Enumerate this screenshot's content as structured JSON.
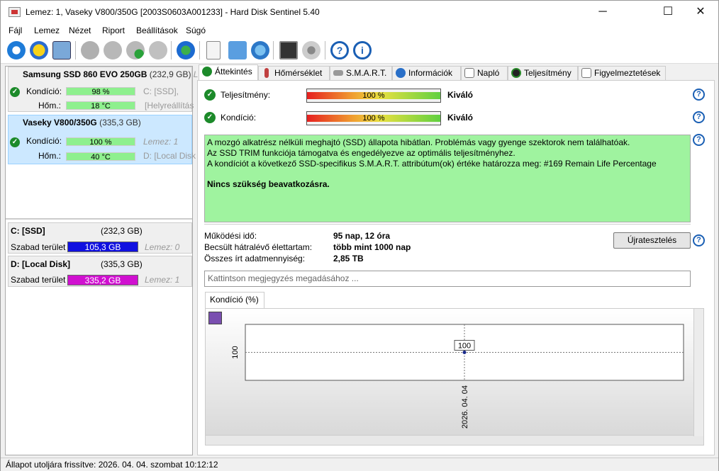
{
  "window": {
    "title": "Lemez: 1, Vaseky V800/350G [2003S0603A001233]  -  Hard Disk Sentinel 5.40",
    "min": "─",
    "max": "☐",
    "close": "✕"
  },
  "menu": [
    "Fájl",
    "Lemez",
    "Nézet",
    "Riport",
    "Beállítások",
    "Súgó"
  ],
  "toolbar_icons": [
    "refresh-icon",
    "warning-icon",
    "disk-icon",
    "disk-test-icon",
    "disk-test-2-icon",
    "disk-ok-icon",
    "disk-search-icon",
    "globe-icon",
    "report-icon",
    "sync-icon",
    "network-icon",
    "laptop-icon",
    "speaker-icon",
    "help-icon",
    "info-icon"
  ],
  "disks": [
    {
      "name": "Samsung SSD 860 EVO 250GB",
      "size": "(232,9 GB)",
      "extra": "Le",
      "condition_label": "Kondíció:",
      "condition": "98 %",
      "temp_label": "Hőm.:",
      "temp": "18 °C",
      "side1": "C: [SSD],",
      "side2": "[Helyreállítás"
    },
    {
      "name": "Vaseky V800/350G",
      "size": "(335,3 GB)",
      "condition_label": "Kondíció:",
      "condition": "100 %",
      "temp_label": "Hőm.:",
      "temp": "40 °C",
      "side1": "Lemez: 1",
      "side2": "D: [Local Disk"
    }
  ],
  "volumes": [
    {
      "name": "C: [SSD]",
      "size": "(232,3 GB)",
      "free_label": "Szabad terület",
      "free": "105,3 GB",
      "disk": "Lemez: 0",
      "color": "#1010e0"
    },
    {
      "name": "D: [Local Disk]",
      "size": "(335,3 GB)",
      "free_label": "Szabad terület",
      "free": "335,2 GB",
      "disk": "Lemez: 1",
      "color": "#d010d0"
    }
  ],
  "tabs": [
    "Áttekintés",
    "Hőmérséklet",
    "S.M.A.R.T.",
    "Információk",
    "Napló",
    "Teljesítmény",
    "Figyelmeztetések"
  ],
  "overview": {
    "perf_label": "Teljesítmény:",
    "perf_value": "100 %",
    "perf_text": "Kiváló",
    "perf_level": 1.0,
    "cond_label": "Kondíció:",
    "cond_value": "100 %",
    "cond_text": "Kiváló",
    "cond_level": 1.0,
    "info_lines": [
      "A mozgó alkatrész nélküli meghajtó (SSD) állapota hibátlan. Problémás vagy gyenge szektorok nem találhatóak.",
      "Az SSD TRIM funkciója támogatva és engedélyezve az optimális teljesítményhez.",
      "A kondíciót a következő SSD-specifikus S.M.A.R.T. attribútum(ok) értéke határozza meg:  #169 Remain Life Percentage"
    ],
    "info_bold": "Nincs szükség beavatkozásra.",
    "uptime_label": "Működési idő:",
    "uptime": "95 nap, 12 óra",
    "life_label": "Becsült hátralévő élettartam:",
    "life": "több mint 1000 nap",
    "written_label": "Összes írt adatmennyiség:",
    "written": "2,85 TB",
    "retest_button": "Újratesztelés",
    "note_placeholder": "Kattintson megjegyzés megadásához ...",
    "chart_tab": "Kondíció  (%)"
  },
  "chart_data": {
    "type": "line",
    "series": [
      {
        "values": [
          100
        ]
      }
    ],
    "x": [
      "2026. 04. 04"
    ],
    "yticks": [
      "100"
    ],
    "point_label": "100"
  },
  "status": "Állapot utoljára frissítve: 2026. 04. 04. szombat 10:12:12"
}
